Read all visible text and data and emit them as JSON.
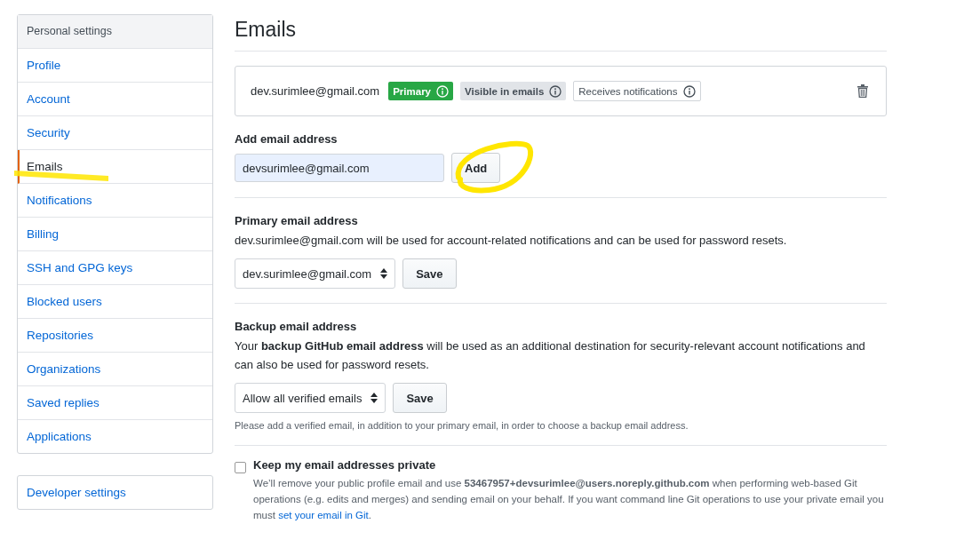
{
  "sidebar": {
    "header": "Personal settings",
    "items": [
      {
        "label": "Profile",
        "selected": false
      },
      {
        "label": "Account",
        "selected": false
      },
      {
        "label": "Security",
        "selected": false
      },
      {
        "label": "Emails",
        "selected": true
      },
      {
        "label": "Notifications",
        "selected": false
      },
      {
        "label": "Billing",
        "selected": false
      },
      {
        "label": "SSH and GPG keys",
        "selected": false
      },
      {
        "label": "Blocked users",
        "selected": false
      },
      {
        "label": "Repositories",
        "selected": false
      },
      {
        "label": "Organizations",
        "selected": false
      },
      {
        "label": "Saved replies",
        "selected": false
      },
      {
        "label": "Applications",
        "selected": false
      }
    ],
    "developer_link": "Developer settings"
  },
  "title": "Emails",
  "email_entry": {
    "address": "dev.surimlee@gmail.com",
    "badges": [
      {
        "label": "Primary",
        "kind": "primary"
      },
      {
        "label": "Visible in emails",
        "kind": "gray"
      },
      {
        "label": "Receives notifications",
        "kind": "outline"
      }
    ]
  },
  "add_email": {
    "label": "Add email address",
    "value": "devsurimlee@gmail.com",
    "button": "Add"
  },
  "primary_email": {
    "label": "Primary email address",
    "description": "dev.surimlee@gmail.com will be used for account-related notifications and can be used for password resets.",
    "select": "dev.surimlee@gmail.com",
    "button": "Save"
  },
  "backup_email": {
    "label": "Backup email address",
    "description": "Your **backup GitHub email address** will be used as an additional destination for security-relevant account notifications and can also be used for password resets.",
    "select": "Allow all verified emails",
    "button": "Save",
    "note": "Please add a verified email, in addition to your primary email, in order to choose a backup email address."
  },
  "keep_private": {
    "label": "Keep my email addresses private",
    "checked": false,
    "description": "We’ll remove your public profile email and use **53467957+devsurimlee@users.noreply.github.com** when performing web-based Git operations (e.g. edits and merges) and sending email on your behalf. If you want command line Git operations to use your private email you must",
    "link": "set your email in Git",
    "after_link": "."
  }
}
